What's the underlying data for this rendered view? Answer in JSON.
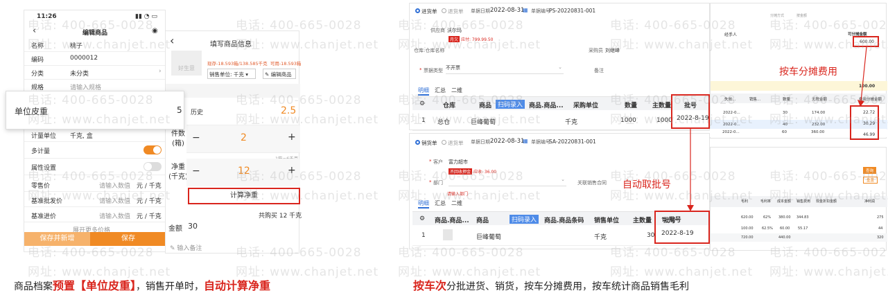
{
  "watermark": {
    "phone": "电话: 400-665-0028",
    "site": "网址: www.chanjet.net"
  },
  "phone_edit": {
    "time": "11:26",
    "title": "编辑商品",
    "rows": [
      {
        "label": "名称",
        "value": "桃子"
      },
      {
        "label": "编码",
        "value": "0000012"
      },
      {
        "label": "分类",
        "value": "未分类"
      },
      {
        "label": "规格",
        "value": "请输入规格"
      }
    ],
    "tare_label": "单位皮重",
    "tare_value": "5",
    "unit_label": "计量单位",
    "unit_value": "千克, 盒",
    "multi_unit": "多计量",
    "attr": "属性设置",
    "prices": [
      {
        "label": "零售价",
        "placeholder": "请输入数值",
        "unit": "元 / 千克"
      },
      {
        "label": "基准批发价",
        "placeholder": "请输入数值",
        "unit": "元 / 千克"
      },
      {
        "label": "基准进价",
        "placeholder": "请输入数值",
        "unit": "元 / 千克"
      }
    ],
    "expand": "展开更多价格",
    "save_new": "保存并新增",
    "save": "保存"
  },
  "phone_fill": {
    "title": "填写商品信息",
    "stock": "现存-18.593箱/138.585千克",
    "avail": "可用-18.593箱",
    "sale_unit": "销售单位: 千克",
    "edit_goods": "编辑商品",
    "history": "历史",
    "price": "2.5",
    "qty_label": "件数(箱)",
    "qty": "2",
    "conv": "1箱=6千克",
    "net_label": "净重(千克)",
    "net": "12",
    "calc": "计算净重",
    "total": "共购买 12 千克",
    "amount_label": "金额",
    "amount": "30",
    "note": "输入备注",
    "logo": "好生意"
  },
  "purchase": {
    "tab_in": "进货单",
    "tab_ret": "退货单",
    "date_label": "单据日期",
    "date": "2022-08-31",
    "no_label": "单据编号",
    "no": "PS-20220831-001",
    "supplier_label": "供应商",
    "supplier": "沃尔玛",
    "owe_tag": "月欠",
    "owe": "应付: 799.99.50",
    "wh_label": "仓库:仓库名称",
    "buyer_label": "采购员",
    "buyer": "刘继峰",
    "kind_label": "票据类型",
    "kind": "不开票",
    "remark_label": "备注",
    "subtabs": [
      "明细",
      "汇总",
      "二维"
    ],
    "headers": [
      "仓库",
      "商品",
      "扫码录入",
      "商品.商品...",
      "采购单位",
      "数量",
      "主数量",
      "批号"
    ],
    "row": {
      "idx": "1",
      "wh": "总仓",
      "goods": "巨峰葡萄",
      "unit": "千克",
      "qty": "1000",
      "main": "1000",
      "batch": "2022-8-19"
    }
  },
  "sale": {
    "tab_sale": "销货单",
    "tab_ret": "退货单",
    "date_label": "单据日期",
    "date": "2022-08-31",
    "no_label": "单据编号",
    "no": "SA-20220831-001",
    "cust_label": "客户",
    "cust": "富力超市",
    "tag": "不回收押金",
    "owe": "应收: 36.00",
    "dept_label": "部门",
    "dept_ph": "请输入部门",
    "contract_label": "关联销售合同",
    "subtabs": [
      "明细",
      "汇总",
      "二维"
    ],
    "headers": [
      "商品.商品...",
      "商品",
      "扫码录入",
      "商品.商品条码",
      "销售单位",
      "主数量",
      "批号"
    ],
    "row": {
      "idx": "1",
      "goods": "巨峰葡萄",
      "unit": "千克",
      "main": "30",
      "batch": "2022-8-19"
    }
  },
  "right_panel": {
    "header": [
      "经手人"
    ],
    "alloc_label": "可分摊金额",
    "alloc_value": "600.00",
    "total": "100.00",
    "cols": [
      "失效...",
      "销售...",
      "数量",
      "无税金额",
      "费用分摊金额"
    ],
    "rows": [
      {
        "date": "2022-0...",
        "qty": "30",
        "amt": "174.00",
        "fee": "22.72"
      },
      {
        "date": "2022-0...",
        "qty": "40",
        "amt": "232.00",
        "fee": "30.29"
      },
      {
        "date": "2022-0...",
        "qty": "60",
        "amt": "360.00",
        "fee": "46.99"
      }
    ],
    "report_cols": [
      "毛利",
      "毛利率",
      "成本金额",
      "销售费用",
      "现金折扣金额",
      "净利润"
    ],
    "report_rows": [
      [
        "620.00",
        "62%",
        "380.00",
        "344.83",
        "",
        "275"
      ],
      [
        "100.00",
        "62.5%",
        "60.00",
        "55.17",
        "",
        "44"
      ],
      [
        "720.00",
        "",
        "440.00",
        "",
        "",
        "320"
      ]
    ],
    "query": "查询",
    "reset": "重置"
  },
  "annotations": {
    "alloc": "按车分摊费用",
    "batch": "自动取批号"
  },
  "captions": {
    "left_1": "商品档案",
    "left_2": "预置【单位皮重】",
    "left_3": "，销售开单时，",
    "left_4": "自动计算净重",
    "right_1": "按车次",
    "right_2": "分批进货、销货，按车分摊费用，按车统计商品销售毛利"
  },
  "colors": {
    "accent_red": "#d9251d",
    "orange": "#f08a24",
    "blue": "#2f6fd6"
  }
}
